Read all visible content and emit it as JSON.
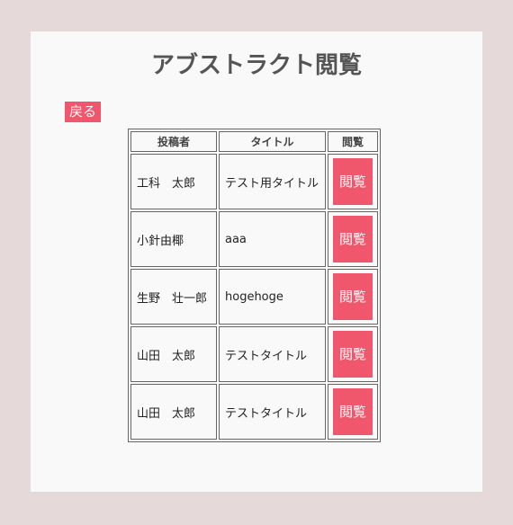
{
  "page": {
    "title": "アブストラクト閲覧",
    "back_label": "戻る"
  },
  "table": {
    "headers": {
      "author": "投稿者",
      "title": "タイトル",
      "view": "閲覧"
    },
    "rows": [
      {
        "author": "工科　太郎",
        "title": "テスト用タイトル",
        "view_label": "閲覧"
      },
      {
        "author": "小針由椰",
        "title": "aaa",
        "view_label": "閲覧"
      },
      {
        "author": "生野　壮一郎",
        "title": "hogehoge",
        "view_label": "閲覧"
      },
      {
        "author": "山田　太郎",
        "title": "テストタイトル",
        "view_label": "閲覧"
      },
      {
        "author": "山田　太郎",
        "title": "テストタイトル",
        "view_label": "閲覧"
      }
    ]
  },
  "colors": {
    "accent": "#f0566c",
    "background": "#e5d9da",
    "card": "#f9f9f9"
  }
}
